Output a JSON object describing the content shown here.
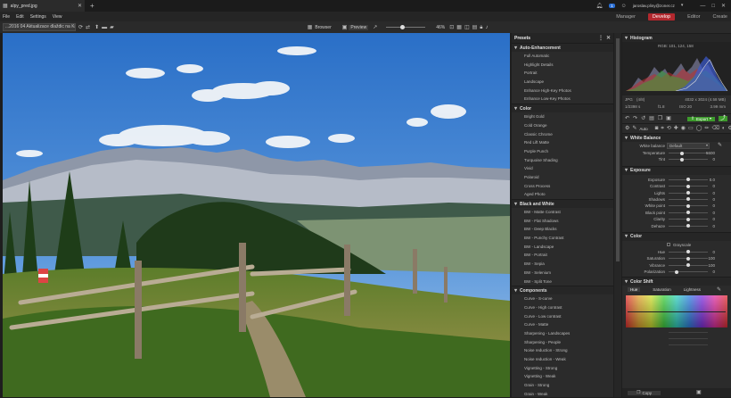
{
  "app": {
    "tab_title": "alpy_pred.jpg",
    "notifications": "1"
  },
  "user": {
    "email": "jaroslav.pliny@zoner.cz"
  },
  "menu": [
    "File",
    "Edit",
    "Settings",
    "View"
  ],
  "modules": [
    "Manager",
    "Develop",
    "Editor",
    "Create"
  ],
  "toolbar": {
    "path": "...2016 04 Aktualizace dlaždic na Krám",
    "browser": "Browser",
    "preview": "Preview",
    "zoom": "46%"
  },
  "presets": {
    "title": "Presets",
    "groups": [
      {
        "name": "Auto-Enhancement",
        "items": [
          "Full Automatic",
          "Highlight Details",
          "Portrait",
          "Landscape",
          "Enhance High-Key Photos",
          "Enhance Low-Key Photos"
        ]
      },
      {
        "name": "Color",
        "items": [
          "Bright Gold",
          "Cold Orange",
          "Classic Chrome",
          "Red Lift Matte",
          "Purple Punch",
          "Turquoise Shading",
          "Vivid",
          "Polaroid",
          "Cross Process",
          "Aged Photo"
        ]
      },
      {
        "name": "Black and White",
        "items": [
          "BW - Matte Contrast",
          "BW - Flat Shadows",
          "BW - Deep Blacks",
          "BW - Punchy Contrast",
          "BW - Landscape",
          "BW - Portrait",
          "BW - Sepia",
          "BW - Selenium",
          "BW - Split Tone"
        ]
      },
      {
        "name": "Components",
        "items": [
          "Curve - S-curve",
          "Curve - High contrast",
          "Curve - Low contrast",
          "Curve - Matte",
          "Sharpening - Landscapes",
          "Sharpening - People",
          "Noise reduction - Strong",
          "Noise reduction - Weak",
          "Vignetting - Strong",
          "Vignetting - Weak",
          "Grain - Strong",
          "Grain - Weak"
        ]
      }
    ]
  },
  "histogram": {
    "title": "Histogram",
    "rgb": "RGB: 101, 124, 158",
    "format": "JPG",
    "bits": "(4/8)",
    "dims": "4032 x 3024 (4.58 MB)",
    "shutter": "1/2398 s",
    "aperture": "f1.8",
    "iso": "ISO 20",
    "focal": "3.99 mm"
  },
  "tools": {
    "auto": "Auto",
    "export": "Export"
  },
  "white_balance": {
    "title": "White Balance",
    "mode_label": "White balance",
    "mode_value": "Default",
    "rows": [
      {
        "label": "Temperature",
        "value": "5600",
        "pos": 0.35
      },
      {
        "label": "Tint",
        "value": "0",
        "pos": 0.35
      }
    ]
  },
  "exposure": {
    "title": "Exposure",
    "rows": [
      {
        "label": "Exposure",
        "value": "0.0",
        "pos": 0.5
      },
      {
        "label": "Contrast",
        "value": "0",
        "pos": 0.5
      },
      {
        "label": "Lights",
        "value": "0",
        "pos": 0.5
      },
      {
        "label": "Shadows",
        "value": "0",
        "pos": 0.5
      },
      {
        "label": "White point",
        "value": "0",
        "pos": 0.5
      },
      {
        "label": "Black point",
        "value": "0",
        "pos": 0.5
      },
      {
        "label": "Clarity",
        "value": "0",
        "pos": 0.5
      },
      {
        "label": "Dehaze",
        "value": "0",
        "pos": 0.5
      }
    ]
  },
  "color": {
    "title": "Color",
    "grayscale": "Grayscale",
    "rows": [
      {
        "label": "Hue",
        "value": "0",
        "pos": 0.5
      },
      {
        "label": "Saturation",
        "value": "100",
        "pos": 0.5
      },
      {
        "label": "Vibrance",
        "value": "100",
        "pos": 0.5
      },
      {
        "label": "Polarization",
        "value": "0",
        "pos": 0.2
      }
    ]
  },
  "color_shift": {
    "title": "Color Shift",
    "tabs": [
      "Hue",
      "Saturation",
      "Lightness"
    ]
  },
  "bottom": {
    "copy": "Copy"
  }
}
